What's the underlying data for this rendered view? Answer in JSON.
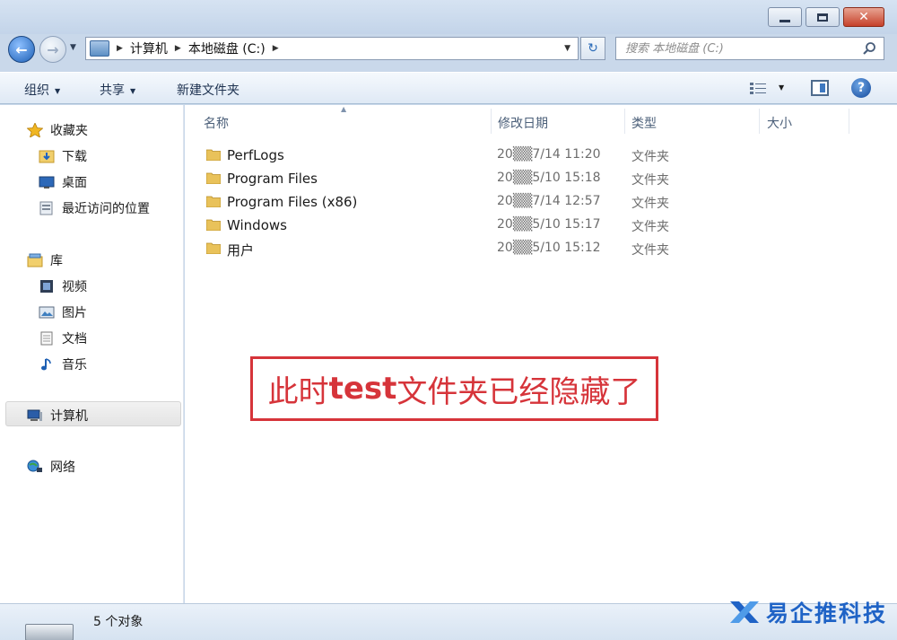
{
  "window": {
    "minimize_icon": "minimize-icon",
    "maximize_icon": "maximize-icon",
    "close_glyph": "✕"
  },
  "nav": {
    "back_glyph": "←",
    "forward_glyph": "→",
    "breadcrumbs": [
      "计算机",
      "本地磁盘 (C:)"
    ],
    "refresh_glyph": "↻",
    "search_placeholder": "搜索 本地磁盘 (C:)"
  },
  "toolbar": {
    "organize": "组织",
    "share": "共享",
    "new_folder": "新建文件夹",
    "help_glyph": "?"
  },
  "sidebar": {
    "favorites": {
      "label": "收藏夹",
      "items": [
        "下载",
        "桌面",
        "最近访问的位置"
      ]
    },
    "libraries": {
      "label": "库",
      "items": [
        "视频",
        "图片",
        "文档",
        "音乐"
      ]
    },
    "computer": "计算机",
    "network": "网络"
  },
  "columns": {
    "name": "名称",
    "date_modified": "修改日期",
    "type": "类型",
    "size": "大小"
  },
  "files": [
    {
      "name": "PerfLogs",
      "date": "20▒▒7/14 11:20",
      "type": "文件夹"
    },
    {
      "name": "Program Files",
      "date": "20▒▒5/10 15:18",
      "type": "文件夹"
    },
    {
      "name": "Program Files (x86)",
      "date": "20▒▒7/14 12:57",
      "type": "文件夹"
    },
    {
      "name": "Windows",
      "date": "20▒▒5/10 15:17",
      "type": "文件夹"
    },
    {
      "name": "用户",
      "date": "20▒▒5/10 15:12",
      "type": "文件夹"
    }
  ],
  "annotation": {
    "prefix": "此时",
    "bold": "test",
    "suffix": "文件夹已经隐藏了"
  },
  "status": {
    "count": "5 个对象"
  },
  "watermark": "易企推科技",
  "colors": {
    "accent": "#1f63c6",
    "callout": "#d6343a",
    "window_frame": "#c9d8ea"
  }
}
